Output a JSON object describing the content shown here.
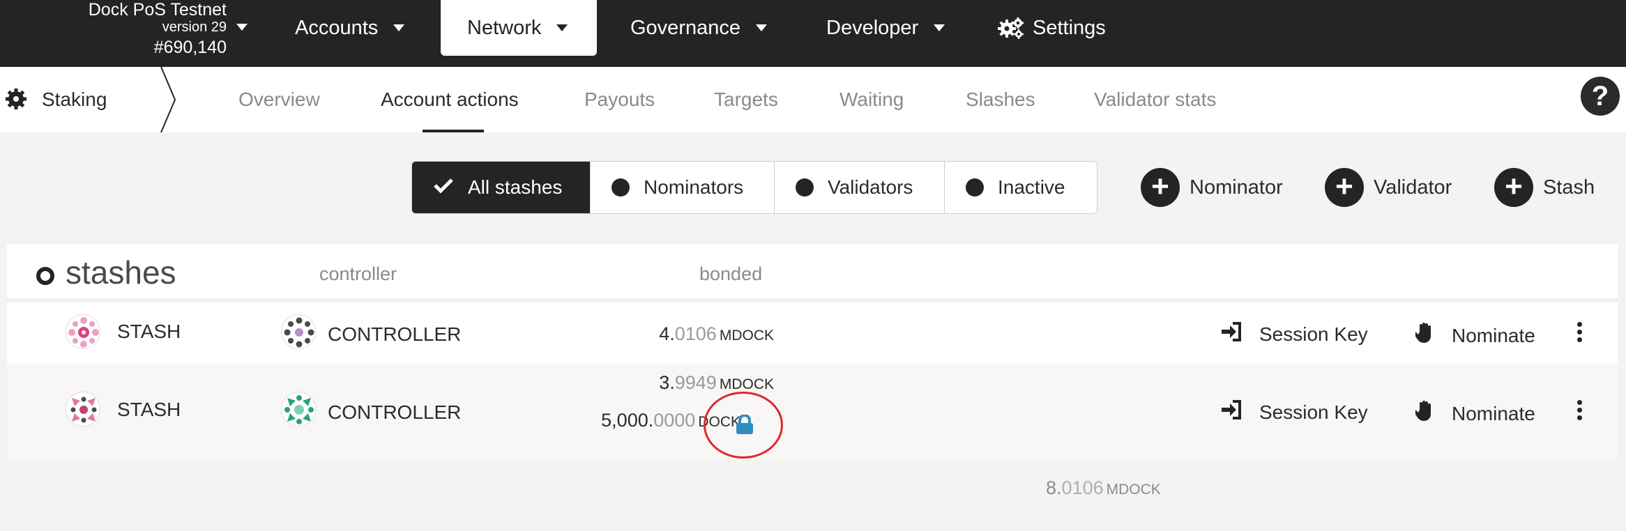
{
  "chain": {
    "name": "Dock PoS Testnet",
    "version": "version 29",
    "block": "#690,140"
  },
  "nav": {
    "accounts": "Accounts",
    "network": "Network",
    "governance": "Governance",
    "developer": "Developer",
    "settings": "Settings"
  },
  "subnav": {
    "section": "Staking",
    "tabs": {
      "overview": "Overview",
      "account_actions": "Account actions",
      "payouts": "Payouts",
      "targets": "Targets",
      "waiting": "Waiting",
      "slashes": "Slashes",
      "validator_stats": "Validator stats"
    },
    "active_tab": "Account actions",
    "help": "?"
  },
  "filters": {
    "all": "All stashes",
    "nominators": "Nominators",
    "validators": "Validators",
    "inactive": "Inactive",
    "selected": "All stashes"
  },
  "add_buttons": {
    "nominator": "Nominator",
    "validator": "Validator",
    "stash": "Stash"
  },
  "table": {
    "title": "stashes",
    "col_controller": "controller",
    "col_bonded": "bonded",
    "rows": [
      {
        "stash": "STASH",
        "controller": "CONTROLLER",
        "bonded_int": "4.",
        "bonded_dec": "0106",
        "bonded_unit": "MDOCK",
        "session_key": "Session Key",
        "nominate": "Nominate"
      },
      {
        "stash": "STASH",
        "controller": "CONTROLLER",
        "bonded_int": "3.",
        "bonded_dec": "9949",
        "bonded_unit": "MDOCK",
        "locked_int": "5,000.",
        "locked_dec": "0000",
        "locked_unit": "DOCK",
        "session_key": "Session Key",
        "nominate": "Nominate"
      }
    ],
    "total_int": "8.",
    "total_dec": "0106",
    "total_unit": "MDOCK"
  },
  "colors": {
    "topbar": "#242424",
    "background": "#f5f3f1",
    "lock": "#2f8ebd",
    "highlight": "#e0262d"
  },
  "icons": {
    "settings": "gears-icon",
    "staking": "gear-icon",
    "session_key": "sign-in-icon",
    "nominate": "hand-icon",
    "lock": "lock-icon"
  }
}
